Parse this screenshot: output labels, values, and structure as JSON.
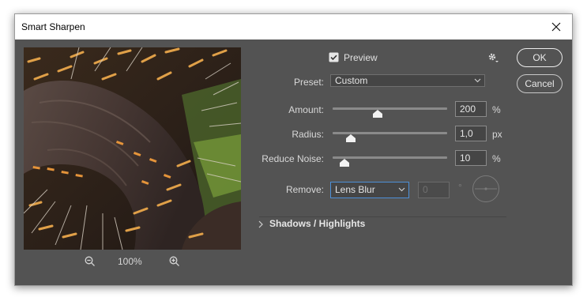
{
  "window": {
    "title": "Smart Sharpen"
  },
  "preview": {
    "label": "Preview",
    "checked": true
  },
  "preset": {
    "label": "Preset:",
    "value": "Custom"
  },
  "amount": {
    "label": "Amount:",
    "value": "200",
    "unit": "%",
    "slider_fraction": 0.39
  },
  "radius": {
    "label": "Radius:",
    "value": "1,0",
    "unit": "px",
    "slider_fraction": 0.16
  },
  "reduce_noise": {
    "label": "Reduce Noise:",
    "value": "10",
    "unit": "%",
    "slider_fraction": 0.1
  },
  "remove": {
    "label": "Remove:",
    "value": "Lens Blur",
    "angle_value": "0",
    "angle_unit": "°"
  },
  "section": {
    "label": "Shadows / Highlights"
  },
  "zoom": {
    "level": "100%"
  },
  "buttons": {
    "ok": "OK",
    "cancel": "Cancel"
  },
  "icons": {
    "close": "close-icon",
    "gear": "gear-icon",
    "zoom_out": "zoom-out-icon",
    "zoom_in": "zoom-in-icon",
    "checkbox": "checkbox-icon",
    "chevron": "chevron-right-icon",
    "angle_dial": "angle-dial-icon"
  },
  "colors": {
    "dialog_bg": "#535353",
    "field_bg": "#454545",
    "accent_border": "#4d8fd6"
  }
}
